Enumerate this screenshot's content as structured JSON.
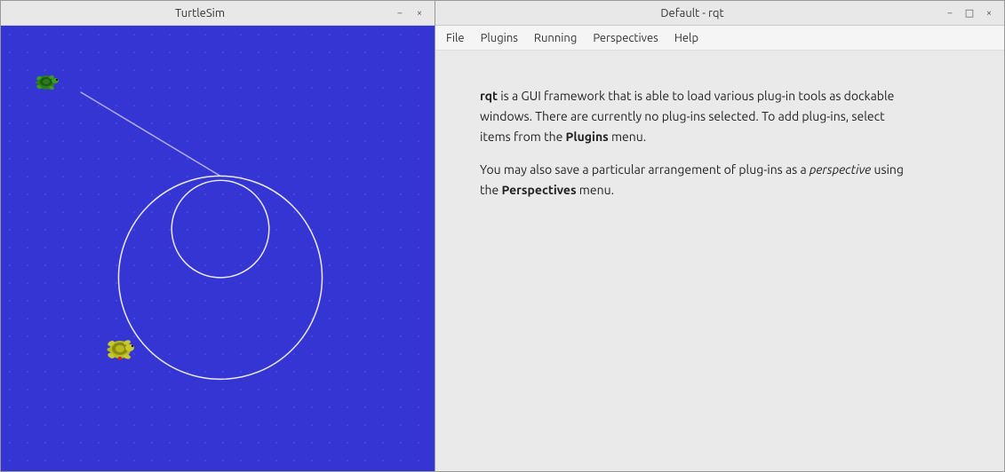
{
  "turtlesim": {
    "title": "TurtleSim",
    "minimize_label": "−",
    "close_label": "×"
  },
  "rqt": {
    "title": "Default - rqt",
    "minimize_label": "−",
    "maximize_label": "□",
    "close_label": "×",
    "menu": {
      "file": "File",
      "plugins": "Plugins",
      "running": "Running",
      "perspectives": "Perspectives",
      "help": "Help"
    },
    "content": {
      "paragraph1_prefix": " is a GUI framework that is able to load various plug-in tools as dockable windows. There are currently no plug-ins selected. To add plug-ins, select items from the ",
      "paragraph1_bold1": "rqt",
      "paragraph1_bold2": "Plugins",
      "paragraph1_suffix": " menu.",
      "paragraph2_prefix": "You may also save a particular arrangement of plug-ins as a ",
      "paragraph2_italic": "perspective",
      "paragraph2_middle": " using the ",
      "paragraph2_bold": "Perspectives",
      "paragraph2_suffix": " menu."
    }
  }
}
